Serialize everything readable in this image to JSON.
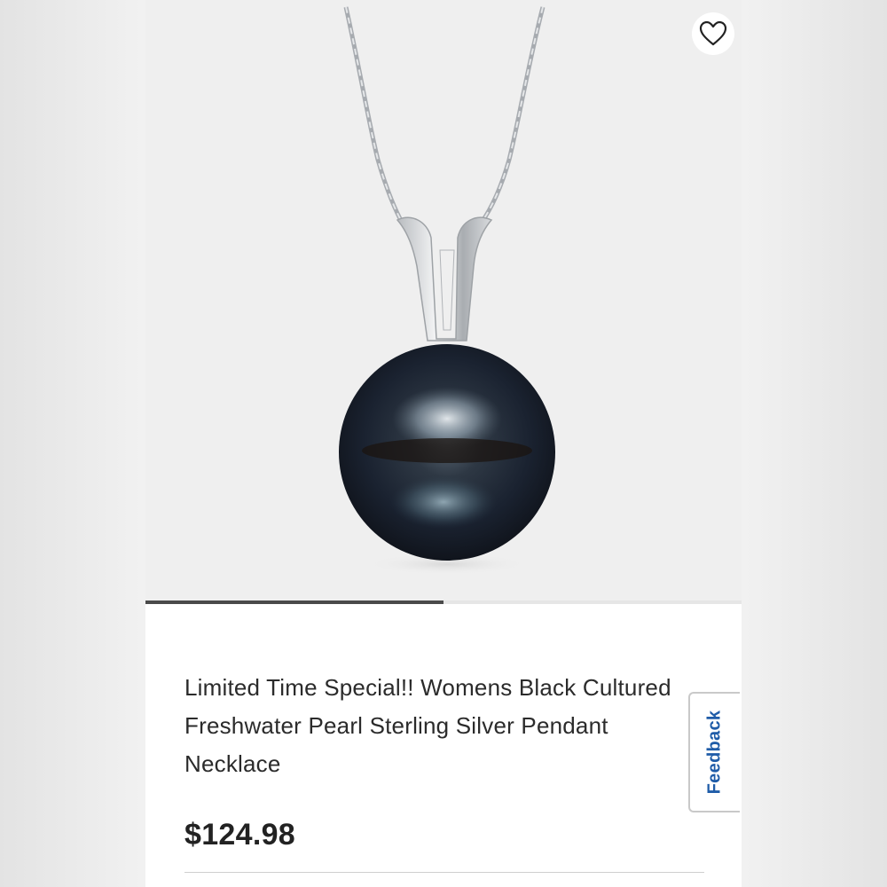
{
  "product": {
    "title": "Limited Time Special!! Womens Black Cultured Freshwater Pearl Sterling Silver Pendant Necklace",
    "price": "$124.98",
    "image_description_icon": "pearl-pendant-necklace-image"
  },
  "favorite": {
    "icon": "heart-outline-icon"
  },
  "carousel": {
    "progress": 0.5
  },
  "feedback": {
    "label": "Feedback"
  },
  "colors": {
    "page_bg": "#f4f4f4",
    "image_bg": "#efefef",
    "title_text": "#2b2b2b",
    "price_text": "#222222",
    "feedback_text": "#1f5ca8",
    "progress_fill": "#4a4a4a"
  }
}
